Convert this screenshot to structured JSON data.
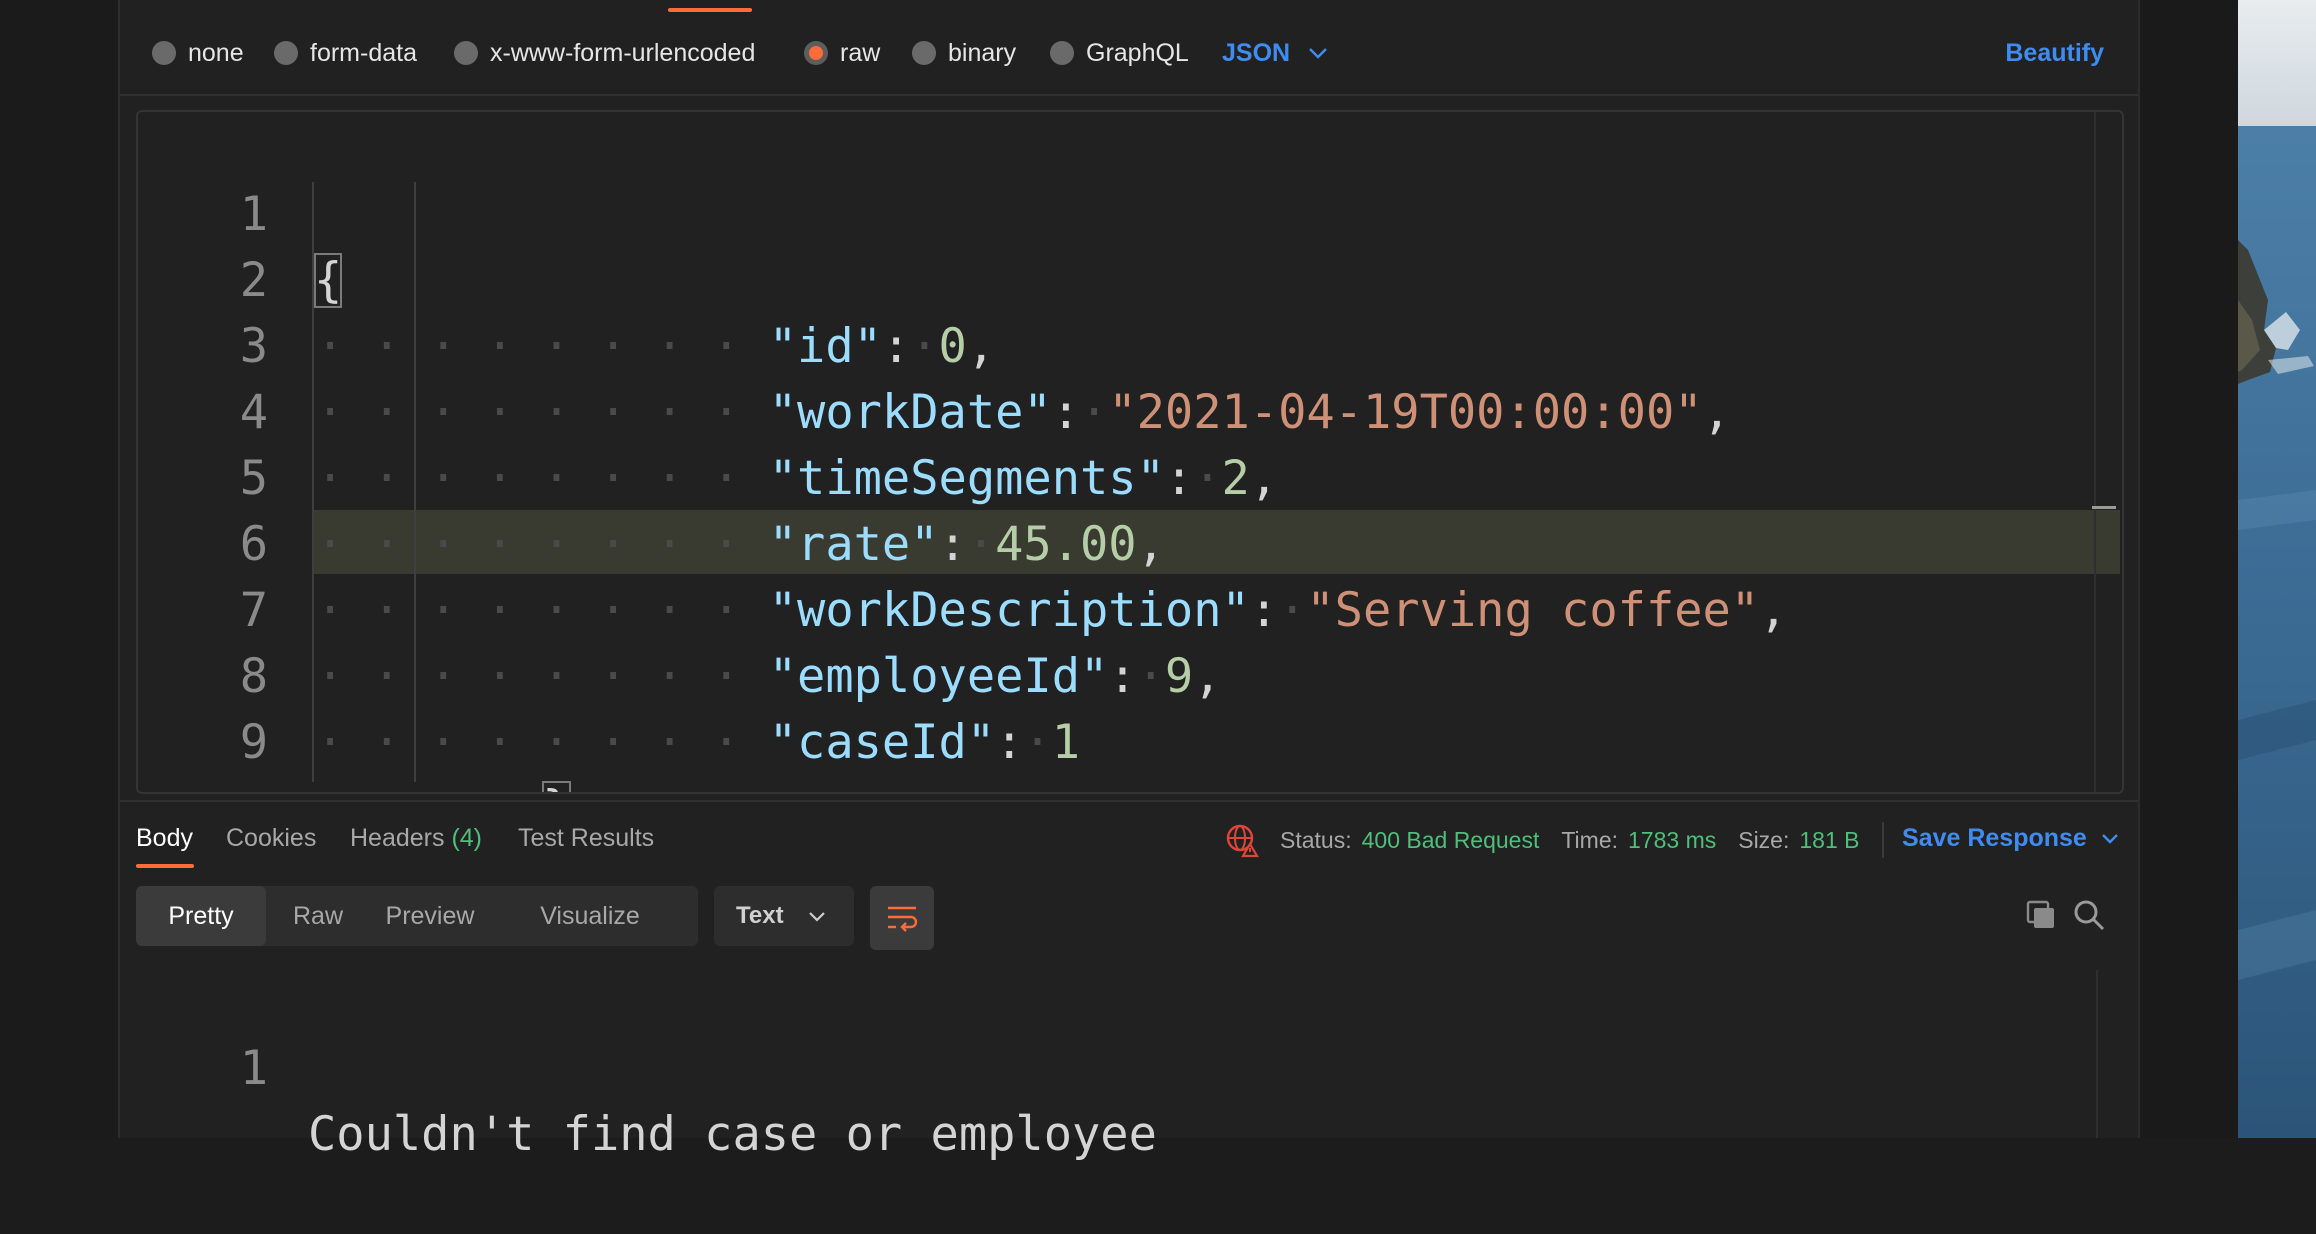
{
  "body_types": {
    "options": [
      {
        "label": "none",
        "selected": false
      },
      {
        "label": "form-data",
        "selected": false
      },
      {
        "label": "x-www-form-urlencoded",
        "selected": false
      },
      {
        "label": "raw",
        "selected": true
      },
      {
        "label": "binary",
        "selected": false
      },
      {
        "label": "GraphQL",
        "selected": false
      }
    ],
    "format": "JSON",
    "beautify": "Beautify"
  },
  "editor": {
    "line_numbers": [
      "1",
      "2",
      "3",
      "4",
      "5",
      "6",
      "7",
      "8",
      "9"
    ],
    "lines": {
      "l1_brace": "{",
      "l2_key": "\"id\"",
      "l2_val": "0",
      "l3_key": "\"workDate\"",
      "l3_val": "\"2021-04-19T00:00:00\"",
      "l4_key": "\"timeSegments\"",
      "l4_val": "2",
      "l5_key": "\"rate\"",
      "l5_val": "45.00",
      "l6_key": "\"workDescription\"",
      "l6_val": "\"Serving coffee\"",
      "l7_key": "\"employeeId\"",
      "l7_val": "9",
      "l8_key": "\"caseId\"",
      "l8_val": "1",
      "l9_brace": "}"
    },
    "highlighted_line": "7"
  },
  "response": {
    "tabs": {
      "body": "Body",
      "cookies": "Cookies",
      "headers": "Headers",
      "headers_count": "(4)",
      "test_results": "Test Results"
    },
    "status_label": "Status:",
    "status_value": "400 Bad Request",
    "time_label": "Time:",
    "time_value": "1783 ms",
    "size_label": "Size:",
    "size_value": "181 B",
    "save_response": "Save Response",
    "view_modes": [
      "Pretty",
      "Raw",
      "Preview",
      "Visualize"
    ],
    "active_view": "Pretty",
    "format": "Text",
    "output_line_number": "1",
    "output_text": "Couldn't find case or employee"
  },
  "colors": {
    "accent": "#ff6c37",
    "link": "#3f8cf0",
    "success": "#4fbf7a",
    "json_key": "#9cdcfe",
    "json_string": "#ce9178",
    "json_number": "#b5cea8"
  },
  "icons": [
    "chevron-down-icon",
    "globe-warning-icon",
    "wrap-lines-icon",
    "copy-icon",
    "search-icon"
  ]
}
